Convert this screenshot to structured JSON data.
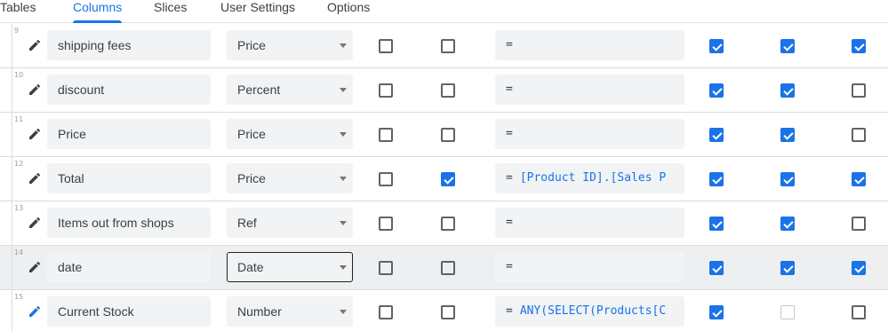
{
  "tabs": [
    {
      "label": "Tables",
      "active": false
    },
    {
      "label": "Columns",
      "active": true
    },
    {
      "label": "Slices",
      "active": false
    },
    {
      "label": "User Settings",
      "active": false
    },
    {
      "label": "Options",
      "active": false
    }
  ],
  "rows": [
    {
      "num": "9",
      "name": "shipping fees",
      "type": "Price",
      "formula": "",
      "checks": [
        false,
        false,
        true,
        true,
        true
      ],
      "disabled": [
        false,
        false,
        false,
        false,
        false
      ],
      "highlighted": false,
      "focused_type": false
    },
    {
      "num": "10",
      "name": "discount",
      "type": "Percent",
      "formula": "",
      "checks": [
        false,
        false,
        true,
        true,
        false
      ],
      "disabled": [
        false,
        false,
        false,
        false,
        false
      ],
      "highlighted": false,
      "focused_type": false
    },
    {
      "num": "11",
      "name": "Price",
      "type": "Price",
      "formula": "",
      "checks": [
        false,
        false,
        true,
        true,
        false
      ],
      "disabled": [
        false,
        false,
        false,
        false,
        false
      ],
      "highlighted": false,
      "focused_type": false
    },
    {
      "num": "12",
      "name": "Total",
      "type": "Price",
      "formula": "[Product ID].[Sales P",
      "checks": [
        false,
        true,
        true,
        true,
        true
      ],
      "disabled": [
        false,
        false,
        false,
        false,
        false
      ],
      "highlighted": false,
      "focused_type": false
    },
    {
      "num": "13",
      "name": "Items out from shops",
      "type": "Ref",
      "formula": "",
      "checks": [
        false,
        false,
        true,
        true,
        false
      ],
      "disabled": [
        false,
        false,
        false,
        false,
        false
      ],
      "highlighted": false,
      "focused_type": false
    },
    {
      "num": "14",
      "name": "date",
      "type": "Date",
      "formula": "",
      "checks": [
        false,
        false,
        true,
        true,
        true
      ],
      "disabled": [
        false,
        false,
        false,
        false,
        false
      ],
      "highlighted": true,
      "focused_type": true
    },
    {
      "num": "15",
      "name": "Current Stock",
      "type": "Number",
      "formula": "ANY(SELECT(Products[C",
      "checks": [
        false,
        false,
        true,
        false,
        false
      ],
      "disabled": [
        false,
        false,
        false,
        true,
        false
      ],
      "highlighted": false,
      "focused_type": false
    }
  ],
  "formula_prefix": "=",
  "colors": {
    "accent": "#1a73e8",
    "highlight_row": "#eeeff1",
    "field_bg": "#f1f3f4"
  },
  "icons": {
    "edit": "pencil-icon",
    "dropdown": "caret-down-icon"
  }
}
